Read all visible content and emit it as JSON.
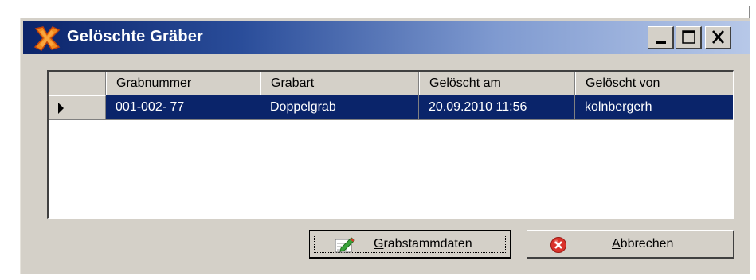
{
  "window": {
    "title": "Gelöschte Gräber"
  },
  "controls": {
    "minimize_icon": "minimize-icon",
    "maximize_icon": "maximize-icon",
    "close_icon": "close-icon"
  },
  "grid": {
    "columns": [
      "Grabnummer",
      "Grabart",
      "Gelöscht am",
      "Gelöscht von"
    ],
    "rows": [
      {
        "selected": true,
        "cells": [
          "001-002-  77",
          "Doppelgrab",
          "20.09.2010 11:56",
          "kolnbergerh"
        ]
      }
    ]
  },
  "buttons": {
    "grabstammdaten": {
      "mnemonic": "G",
      "rest": "rabstammdaten"
    },
    "abbrechen": {
      "mnemonic": "A",
      "rest": "bbrechen"
    }
  },
  "colors": {
    "selection": "#0a246a",
    "titlebar_start": "#0b246a",
    "titlebar_end": "#b7c8e8",
    "face": "#d4d0c8"
  }
}
